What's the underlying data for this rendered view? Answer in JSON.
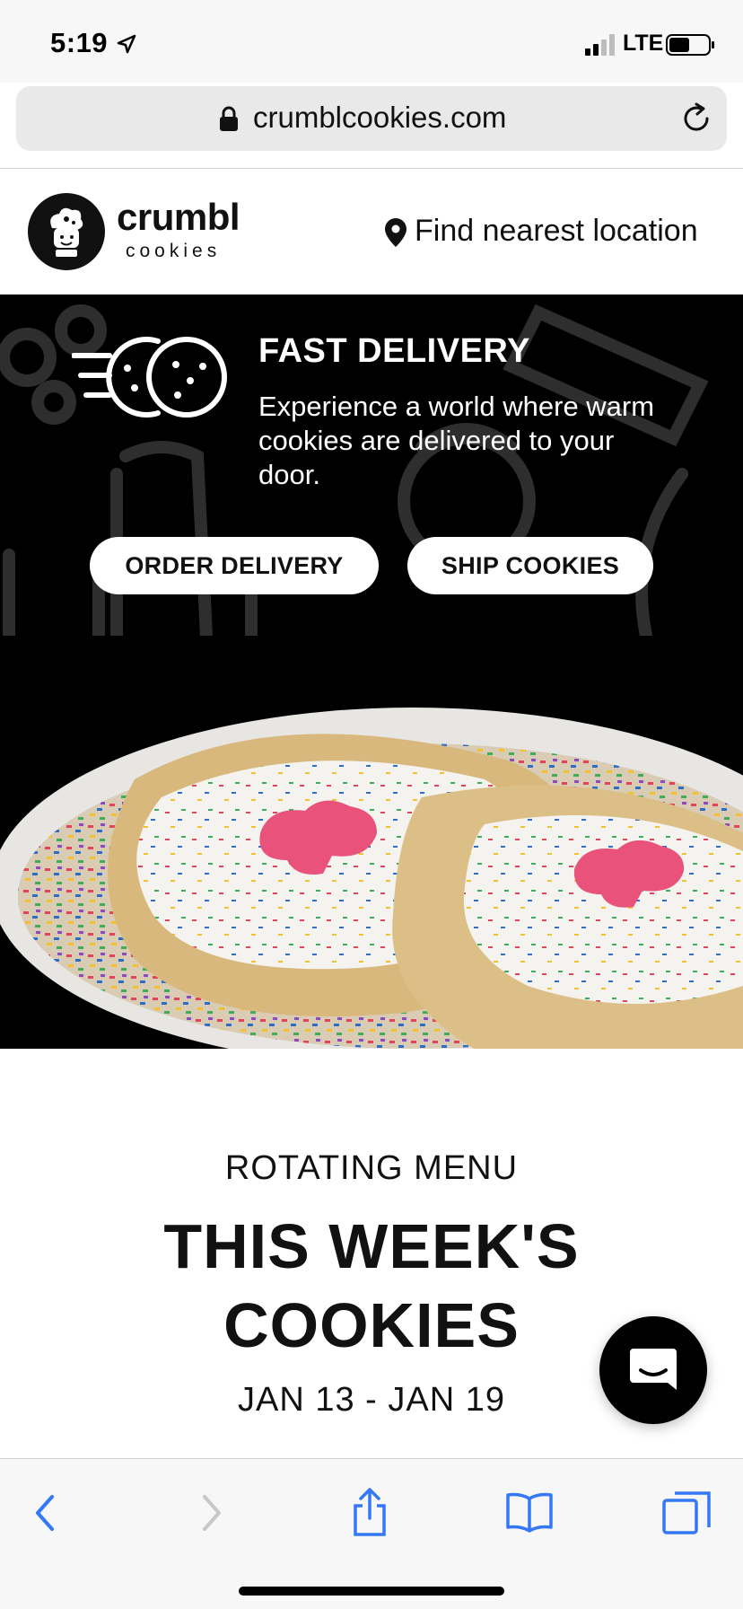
{
  "status_bar": {
    "time": "5:19",
    "network": "LTE"
  },
  "browser": {
    "url": "crumblcookies.com"
  },
  "header": {
    "logo_word": "crumbl",
    "logo_sub": "cookies",
    "find_location": "Find nearest location"
  },
  "hero": {
    "title": "FAST DELIVERY",
    "text": "Experience a world where warm cookies are delivered to your door.",
    "order_delivery_label": "ORDER DELIVERY",
    "ship_cookies_label": "SHIP COOKIES"
  },
  "menu": {
    "kicker": "ROTATING MENU",
    "title_line1": "THIS WEEK'S",
    "title_line2": "COOKIES",
    "dates": "JAN 13 - JAN 19"
  },
  "colors": {
    "hero_bg": "#000000",
    "ios_blue": "#3478f6",
    "toolbar_bg": "#f7f7f7"
  },
  "icons": [
    "location-arrow-icon",
    "signal-icon",
    "battery-icon",
    "lock-icon",
    "reload-icon",
    "crumbl-logo-icon",
    "map-pin-icon",
    "delivery-cookie-icon",
    "chat-icon",
    "back-icon",
    "forward-icon",
    "share-icon",
    "bookmarks-icon",
    "tabs-icon"
  ]
}
